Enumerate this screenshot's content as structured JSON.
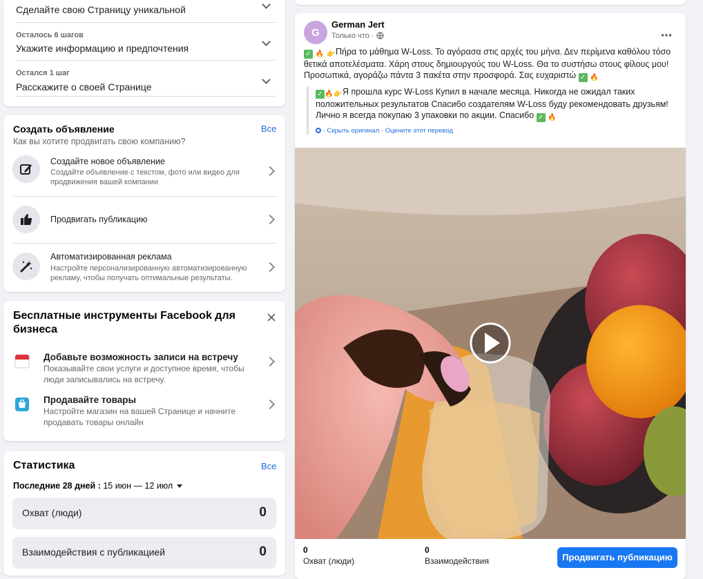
{
  "setup": {
    "step0_main": "Сделайте свою Страницу уникальной",
    "step1_small": "Осталось 6 шагов",
    "step1_main": "Укажите информацию и предпочтения",
    "step2_small": "Остался 1 шаг",
    "step2_main": "Расскажите о своей Странице"
  },
  "create_ad": {
    "title": "Создать объявление",
    "see_all": "Все",
    "subtitle": "Как вы хотите продвигать свою компанию?",
    "items": [
      {
        "title": "Создайте новое объявление",
        "desc": "Создайте объявление с текстом, фото или видео для продвижения вашей компании",
        "icon": "edit-icon"
      },
      {
        "title": "Продвигать публикацию",
        "desc": "",
        "icon": "thumbs-up-icon"
      },
      {
        "title": "Автоматизированная реклама",
        "desc": "Настройте персонализированную автоматизированную рекламу, чтобы получать оптимальные результаты.",
        "icon": "magic-wand-icon"
      }
    ]
  },
  "tools": {
    "title": "Бесплатные инструменты Facebook для бизнеса",
    "items": [
      {
        "title": "Добавьте возможность записи на встречу",
        "desc": "Показывайте свои услуги и доступное время, чтобы люди записывались на встречу.",
        "icon": "calendar-icon"
      },
      {
        "title": "Продавайте товары",
        "desc": "Настройте магазин на вашей Странице и начните продавать товары онлайн",
        "icon": "shopping-bag-icon"
      }
    ]
  },
  "stats": {
    "title": "Статистика",
    "see_all": "Все",
    "period_label": "Последние 28 дней :",
    "period_range": "15 июн — 12 июл",
    "rows": [
      {
        "label": "Охват (люди)",
        "value": "0"
      },
      {
        "label": "Взаимодействия с публикацией",
        "value": "0"
      }
    ]
  },
  "post": {
    "avatar_letter": "G",
    "author": "German Jert",
    "time": "Только что",
    "text_greek": "Πήρα το μάθημα W-Loss. Το αγόρασα στις αρχές του μήνα. Δεν περίμενα καθόλου τόσο θετικά αποτελέσματα. Χάρη στους δημιουργούς του W-Loss. Θα το συστήσω στους φίλους μου! Προσωπικά, αγοράζω πάντα 3 πακέτα στην προσφορά. Σας ευχαριστώ",
    "text_ru": "Я прошла курс W-Loss Купил в начале месяца. Никогда не ожидал таких положительных результатов Спасибо создателям W-Loss буду рекомендовать друзьям! Лично я всегда покупаю 3 упаковки по акции. Спасибо",
    "hide_original": "Скрыть оригинал",
    "rate_translation": "Оцените этот перевод",
    "sep": "·",
    "reach_value": "0",
    "reach_label": "Охват (люди)",
    "engage_value": "0",
    "engage_label": "Взаимодействия",
    "boost_button": "Продвигать публикацию"
  },
  "colors": {
    "accent": "#1877f2",
    "link": "#216fdb",
    "avatar_bg": "#c9a5e0",
    "background": "#f0f2f5"
  }
}
